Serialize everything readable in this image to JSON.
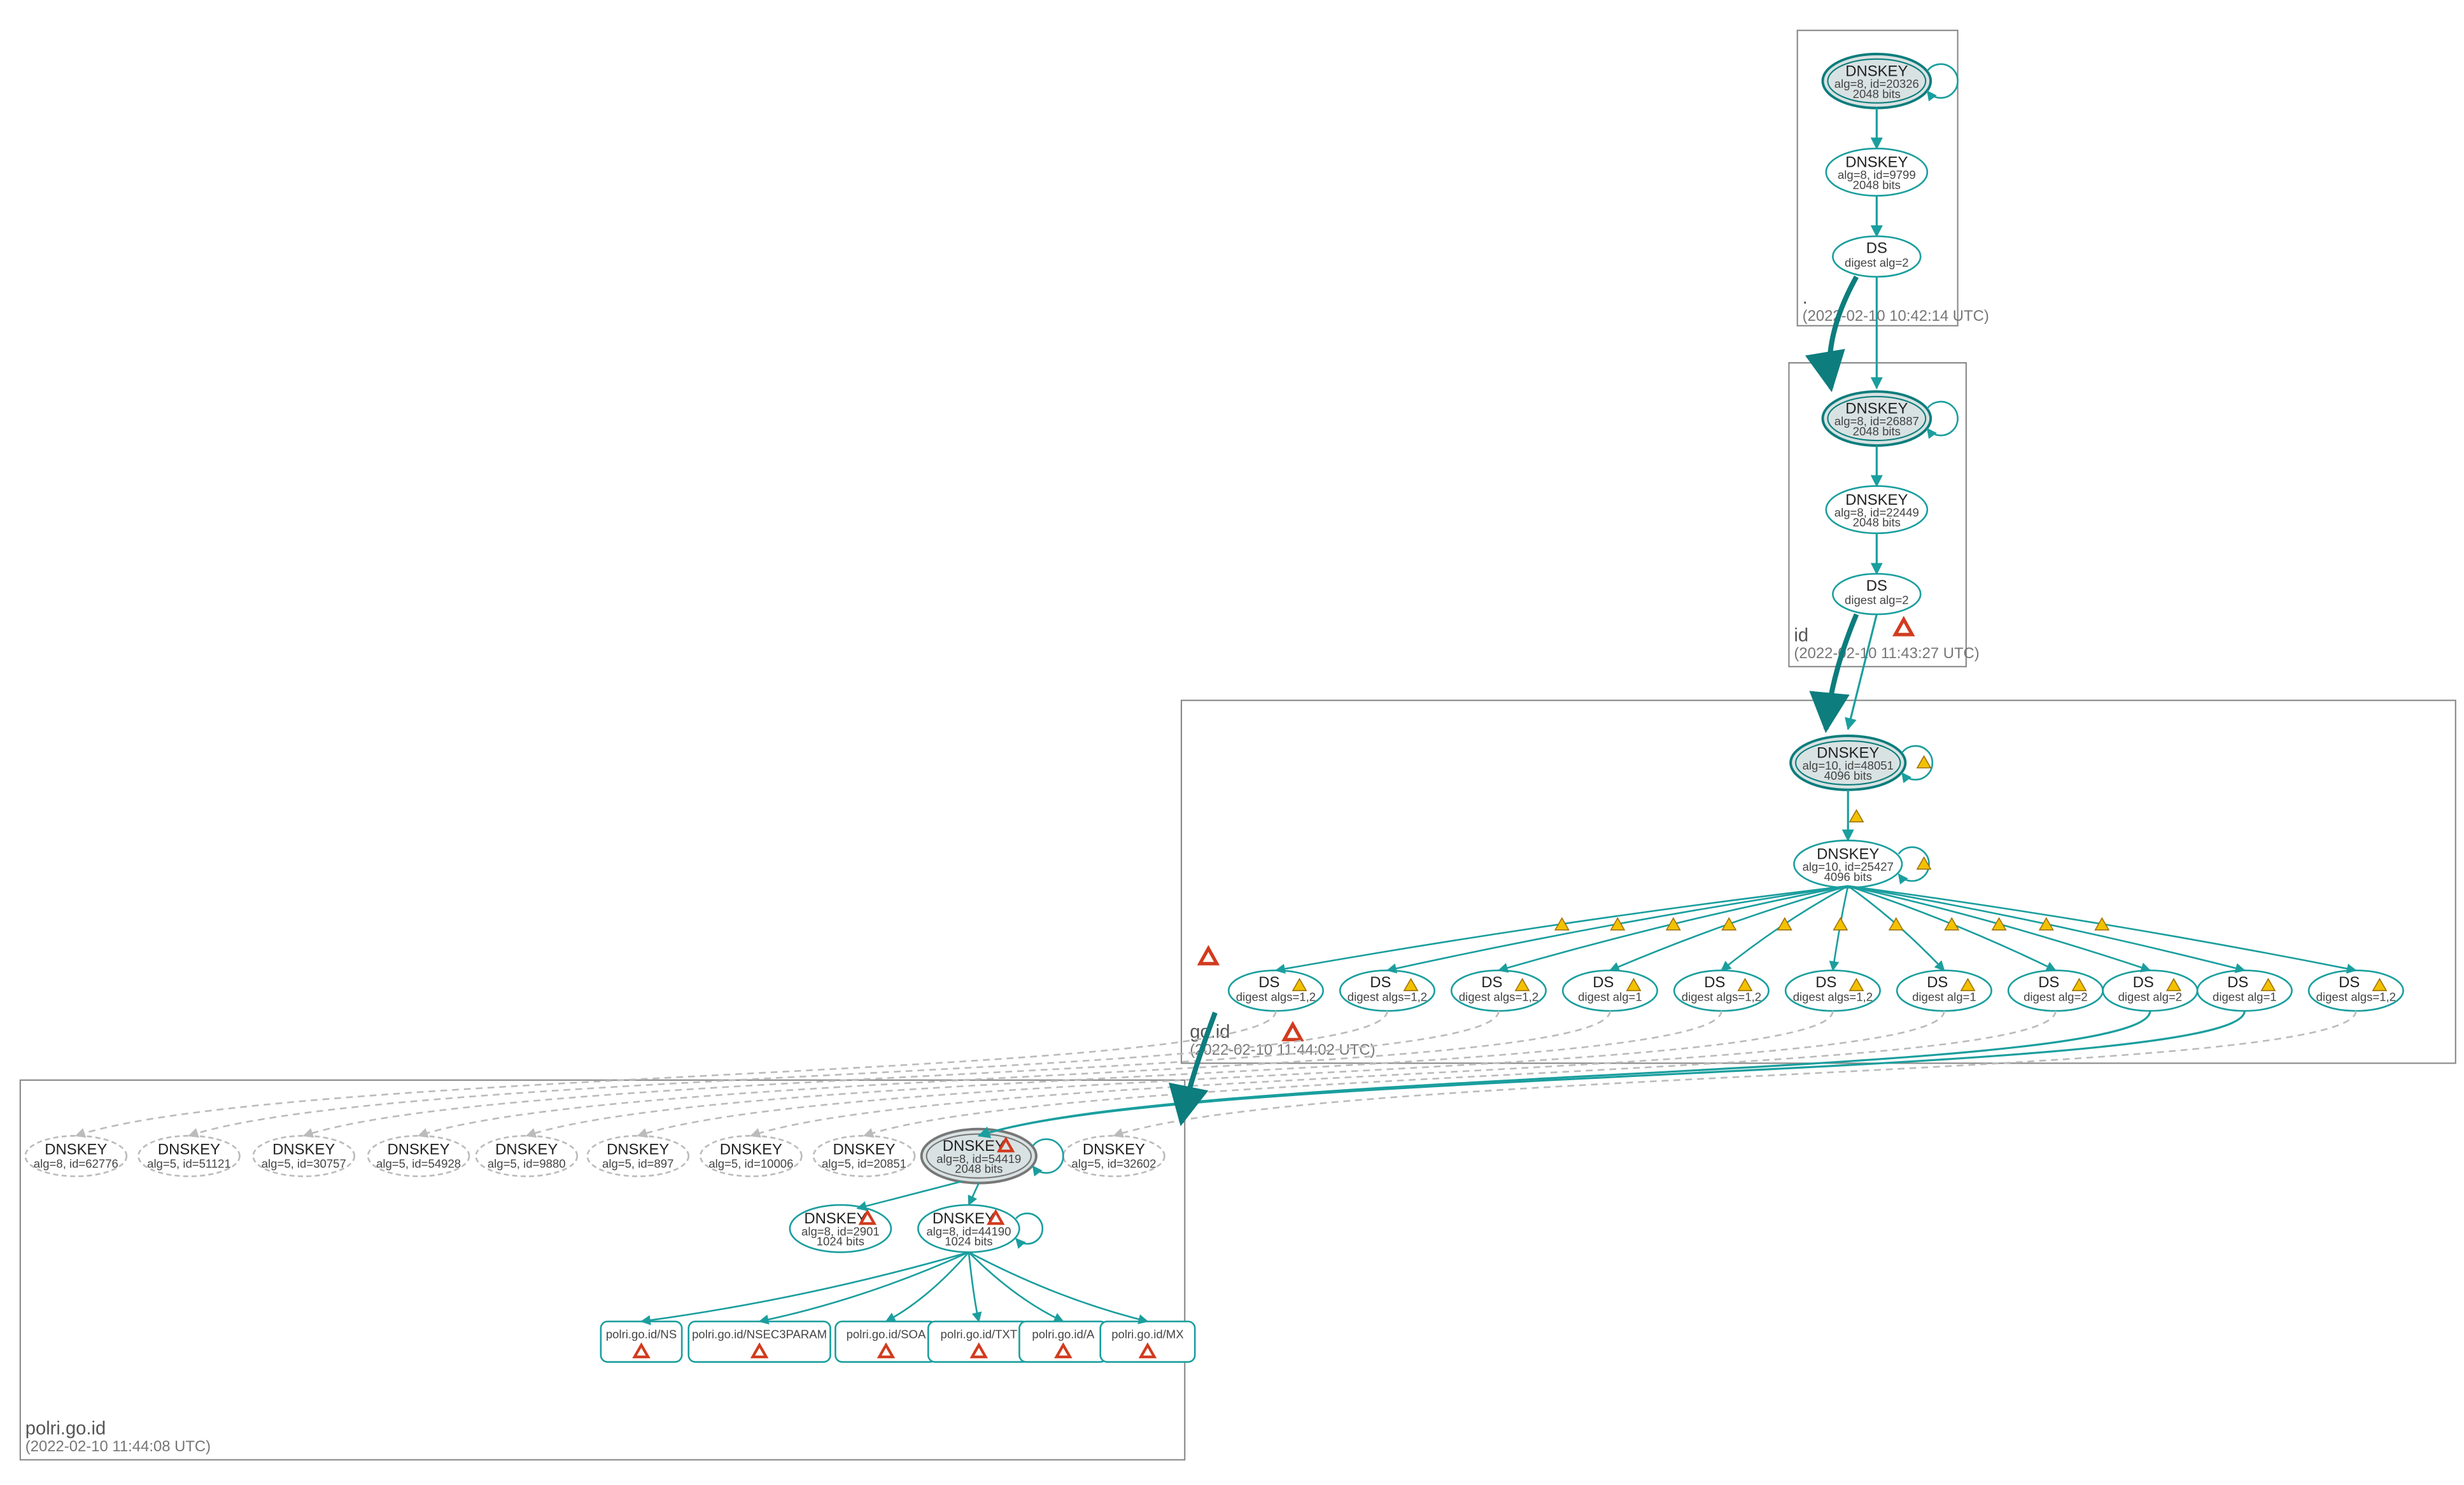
{
  "zones": {
    "root": {
      "label": ".",
      "timestamp": "(2022-02-10 10:42:14 UTC)"
    },
    "id": {
      "label": "id",
      "timestamp": "(2022-02-10 11:43:27 UTC)"
    },
    "goid": {
      "label": "go.id",
      "timestamp": "(2022-02-10 11:44:02 UTC)"
    },
    "polri": {
      "label": "polri.go.id",
      "timestamp": "(2022-02-10 11:44:08 UTC)"
    }
  },
  "nodes": {
    "root_ksk": {
      "title": "DNSKEY",
      "line2": "alg=8, id=20326",
      "line3": "2048 bits"
    },
    "root_zsk": {
      "title": "DNSKEY",
      "line2": "alg=8, id=9799",
      "line3": "2048 bits"
    },
    "root_ds": {
      "title": "DS",
      "line2": "digest alg=2"
    },
    "id_ksk": {
      "title": "DNSKEY",
      "line2": "alg=8, id=26887",
      "line3": "2048 bits"
    },
    "id_zsk": {
      "title": "DNSKEY",
      "line2": "alg=8, id=22449",
      "line3": "2048 bits"
    },
    "id_ds": {
      "title": "DS",
      "line2": "digest alg=2"
    },
    "goid_ksk": {
      "title": "DNSKEY",
      "line2": "alg=10, id=48051",
      "line3": "4096 bits"
    },
    "goid_zsk": {
      "title": "DNSKEY",
      "line2": "alg=10, id=25427",
      "line3": "4096 bits"
    },
    "ds1": {
      "title": "DS",
      "line2": "digest algs=1,2"
    },
    "ds2": {
      "title": "DS",
      "line2": "digest algs=1,2"
    },
    "ds3": {
      "title": "DS",
      "line2": "digest algs=1,2"
    },
    "ds4": {
      "title": "DS",
      "line2": "digest alg=1"
    },
    "ds5": {
      "title": "DS",
      "line2": "digest algs=1,2"
    },
    "ds6": {
      "title": "DS",
      "line2": "digest algs=1,2"
    },
    "ds7": {
      "title": "DS",
      "line2": "digest alg=1"
    },
    "ds8": {
      "title": "DS",
      "line2": "digest alg=2"
    },
    "ds9": {
      "title": "DS",
      "line2": "digest alg=2"
    },
    "ds10": {
      "title": "DS",
      "line2": "digest alg=1"
    },
    "ds11": {
      "title": "DS",
      "line2": "digest algs=1,2"
    },
    "dk_a": {
      "title": "DNSKEY",
      "line2": "alg=8, id=62776"
    },
    "dk_b": {
      "title": "DNSKEY",
      "line2": "alg=5, id=51121"
    },
    "dk_c": {
      "title": "DNSKEY",
      "line2": "alg=5, id=30757"
    },
    "dk_d": {
      "title": "DNSKEY",
      "line2": "alg=5, id=54928"
    },
    "dk_e": {
      "title": "DNSKEY",
      "line2": "alg=5, id=9880"
    },
    "dk_f": {
      "title": "DNSKEY",
      "line2": "alg=5, id=897"
    },
    "dk_g": {
      "title": "DNSKEY",
      "line2": "alg=5, id=10006"
    },
    "dk_h": {
      "title": "DNSKEY",
      "line2": "alg=5, id=20851"
    },
    "dk_i": {
      "title": "DNSKEY",
      "line2": "alg=5, id=32602"
    },
    "polri_ksk": {
      "title": "DNSKEY",
      "line2": "alg=8, id=54419",
      "line3": "2048 bits"
    },
    "polri_zsk1": {
      "title": "DNSKEY",
      "line2": "alg=8, id=2901",
      "line3": "1024 bits"
    },
    "polri_zsk2": {
      "title": "DNSKEY",
      "line2": "alg=8, id=44190",
      "line3": "1024 bits"
    },
    "rr_ns": {
      "title": "polri.go.id/NS"
    },
    "rr_nsec3": {
      "title": "polri.go.id/NSEC3PARAM"
    },
    "rr_soa": {
      "title": "polri.go.id/SOA"
    },
    "rr_txt": {
      "title": "polri.go.id/TXT"
    },
    "rr_a": {
      "title": "polri.go.id/A"
    },
    "rr_mx": {
      "title": "polri.go.id/MX"
    }
  },
  "colors": {
    "teal": "#1b9e9e",
    "tealDark": "#0d7d7d",
    "gray": "#999",
    "grayLight": "#ccc",
    "shade": "#d9e2e2",
    "shadeDark": "#bfcaca",
    "warn": "#f2c200",
    "err": "#d13b1e"
  }
}
